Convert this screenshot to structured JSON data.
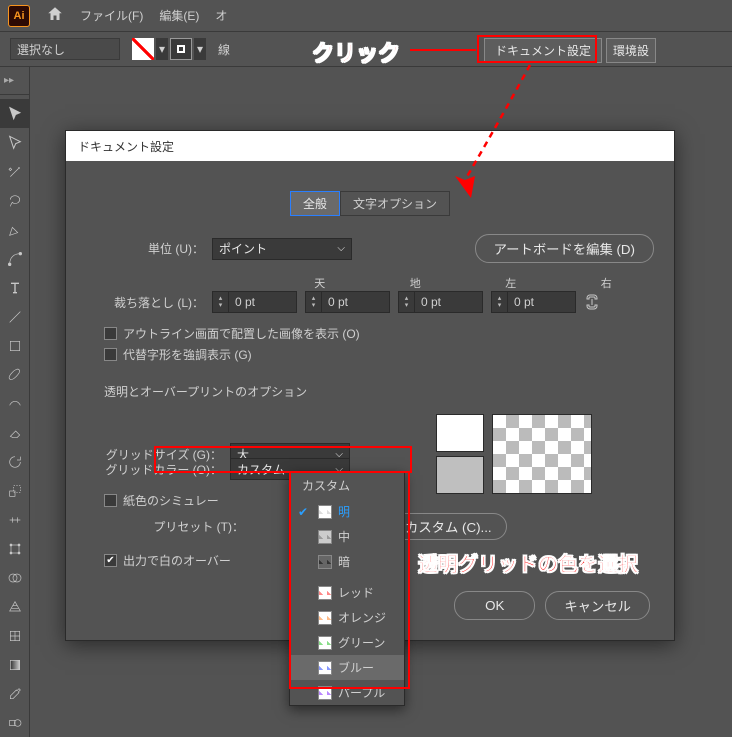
{
  "menubar": {
    "file": "ファイル(F)",
    "edit": "編集(E)",
    "object_partial": "オ"
  },
  "propbar": {
    "selection": "選択なし",
    "doc_settings": "ドキュメント設定",
    "env_partial": "環境設",
    "other_partial": "線"
  },
  "annotation": {
    "click": "クリック",
    "select_grid_color": "透明グリッドの色を選択"
  },
  "dialog": {
    "title": "ドキュメント設定",
    "tabs": {
      "general": "全般",
      "text_options": "文字オプション"
    },
    "unit_label": "単位 (U)：",
    "unit_value": "ポイント",
    "edit_artboards": "アートボードを編集 (D)",
    "bleed_label": "裁ち落とし (L)：",
    "bleed": {
      "top": "天",
      "bottom": "地",
      "left": "左",
      "right": "右",
      "value": "0 pt"
    },
    "show_outline": "アウトライン画面で配置した画像を表示 (O)",
    "alt_glyphs": "代替字形を強調表示 (G)",
    "transparency_section": "透明とオーバープリントのオプション",
    "grid_size_label": "グリッドサイズ (G)：",
    "grid_size_value": "大",
    "grid_color_label": "グリッドカラー (O)：",
    "grid_color_value": "カスタム",
    "simulate_paper": "紙色のシミュレー",
    "preset_label": "プリセット (T)：",
    "custom_btn": "カスタム (C)...",
    "output_white": "出力で白のオーバー",
    "ok": "OK",
    "cancel": "キャンセル"
  },
  "popup": {
    "header": "カスタム",
    "options": [
      "明",
      "中",
      "暗",
      "レッド",
      "オレンジ",
      "グリーン",
      "ブルー",
      "パープル"
    ]
  }
}
